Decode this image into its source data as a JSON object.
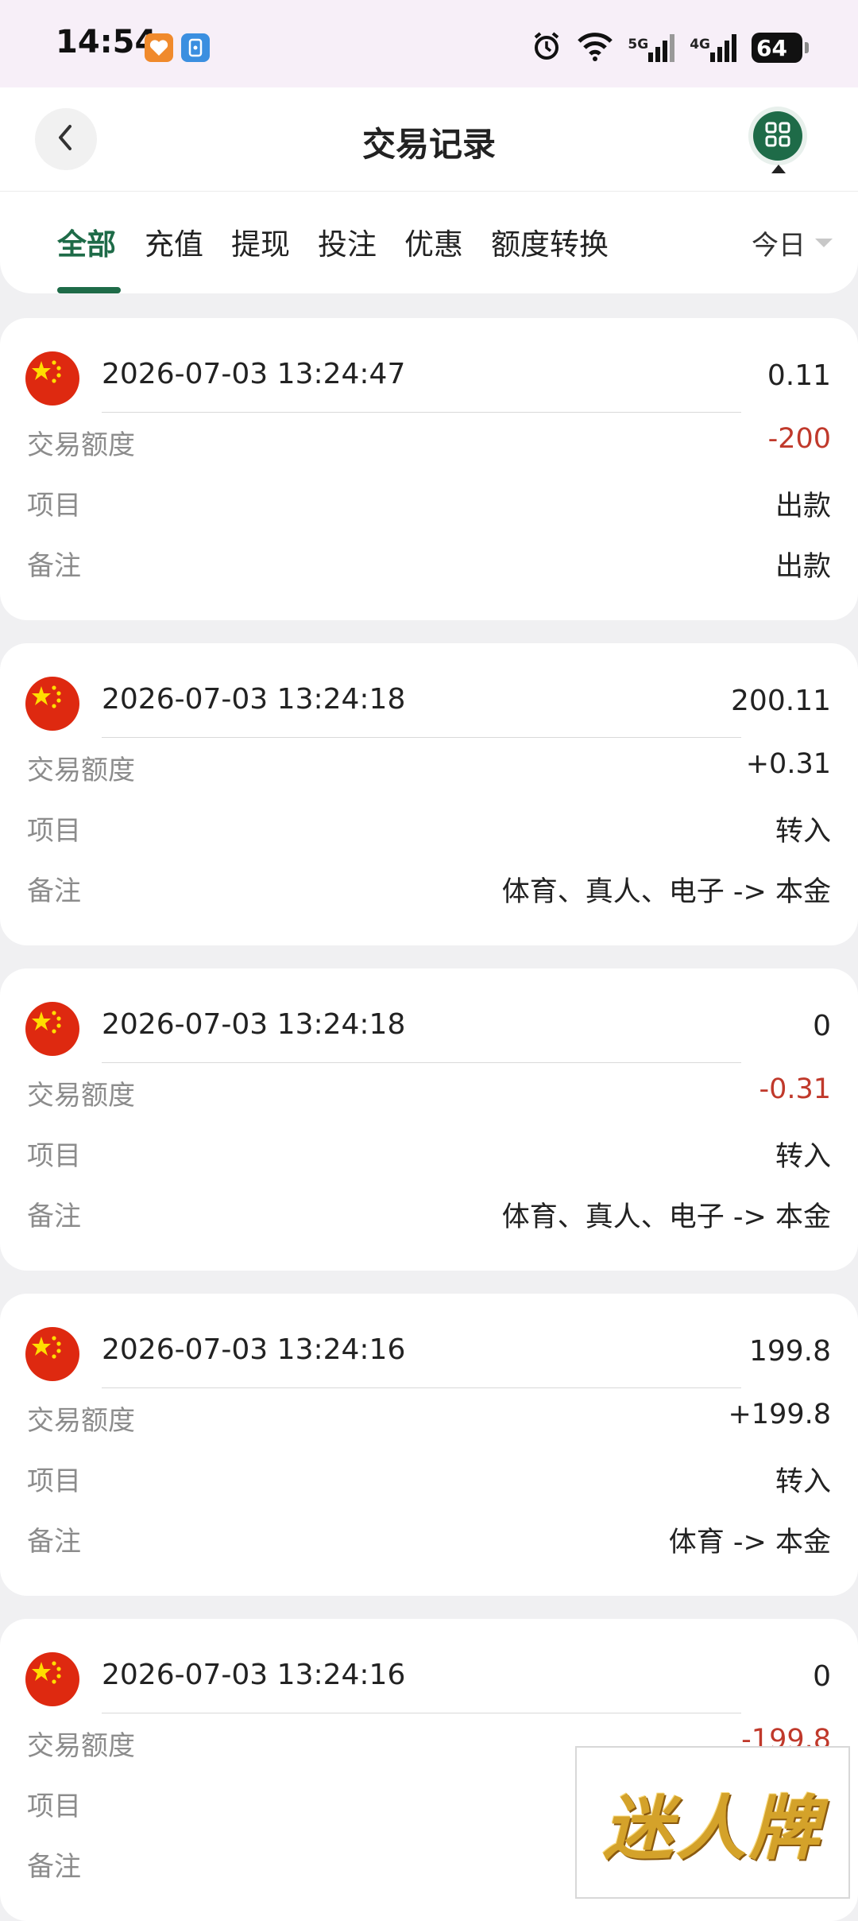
{
  "status_bar": {
    "time": "14:54",
    "battery": "64",
    "net_5g": "5G",
    "net_4g": "4G"
  },
  "header": {
    "title": "交易记录"
  },
  "tabs": [
    {
      "label": "全部",
      "active": true
    },
    {
      "label": "充值",
      "active": false
    },
    {
      "label": "提现",
      "active": false
    },
    {
      "label": "投注",
      "active": false
    },
    {
      "label": "优惠",
      "active": false
    },
    {
      "label": "额度转换",
      "active": false
    }
  ],
  "date_filter": {
    "selected": "今日"
  },
  "row_labels": {
    "amount": "交易额度",
    "item": "项目",
    "note": "备注"
  },
  "records": [
    {
      "time": "2026-07-03 13:24:47",
      "balance": "0.11",
      "amount": "-200",
      "amount_negative": true,
      "item": "出款",
      "note": "出款"
    },
    {
      "time": "2026-07-03 13:24:18",
      "balance": "200.11",
      "amount": "+0.31",
      "amount_negative": false,
      "item": "转入",
      "note": "体育、真人、电子 -> 本金"
    },
    {
      "time": "2026-07-03 13:24:18",
      "balance": "0",
      "amount": "-0.31",
      "amount_negative": true,
      "item": "转入",
      "note": "体育、真人、电子 -> 本金"
    },
    {
      "time": "2026-07-03 13:24:16",
      "balance": "199.8",
      "amount": "+199.8",
      "amount_negative": false,
      "item": "转入",
      "note": "体育 -> 本金"
    },
    {
      "time": "2026-07-03 13:24:16",
      "balance": "0",
      "amount": "-199.8",
      "amount_negative": true,
      "item": "",
      "note": ""
    }
  ],
  "watermark": {
    "text": "迷人牌"
  },
  "colors": {
    "brand_green": "#1e6b48",
    "negative_red": "#c0392b",
    "label_gray": "#8c8c8c",
    "page_bg": "#f0f0f2"
  },
  "icons": {
    "back": "chevron-left-icon",
    "menu": "grid-icon",
    "flag": "china-flag-icon",
    "alarm": "alarm-icon",
    "wifi": "wifi-icon",
    "signal": "signal-icon",
    "battery": "battery-icon"
  }
}
